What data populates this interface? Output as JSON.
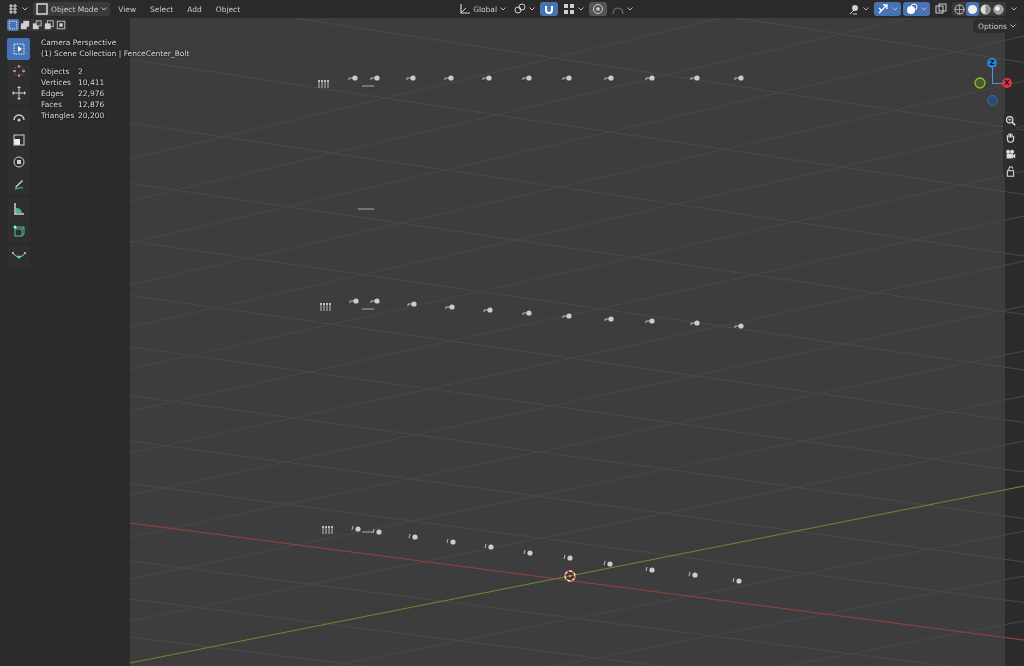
{
  "header": {
    "editor_type": {
      "kind": "editor"
    },
    "mode": {
      "label": "Object Mode"
    },
    "menus": [
      "View",
      "Select",
      "Add",
      "Object"
    ],
    "center_tools": [
      {
        "kind": "orientation",
        "label": "Global"
      },
      {
        "kind": "pivot"
      },
      {
        "kind": "snap",
        "on": true
      },
      {
        "kind": "snap_target"
      },
      {
        "kind": "proportional",
        "on": false
      },
      {
        "kind": "falloff"
      }
    ],
    "right_tools": [
      {
        "kind": "visibility"
      },
      {
        "kind": "gizmos",
        "on": true
      },
      {
        "kind": "overlays",
        "on": true
      },
      {
        "kind": "xray",
        "on": false
      }
    ],
    "shading": [
      {
        "kind": "wireframe",
        "selected": false
      },
      {
        "kind": "solid",
        "selected": true
      },
      {
        "kind": "material",
        "selected": false
      },
      {
        "kind": "rendered",
        "selected": false
      }
    ]
  },
  "select_modes": [
    {
      "kind": "set",
      "selected": true
    },
    {
      "kind": "extend",
      "selected": false
    },
    {
      "kind": "subtract",
      "selected": false
    },
    {
      "kind": "difference",
      "selected": false
    },
    {
      "kind": "intersect",
      "selected": false
    }
  ],
  "tools": [
    {
      "kind": "select_box",
      "selected": true
    },
    {
      "kind": "cursor",
      "selected": false
    },
    {
      "kind": "move",
      "selected": false
    },
    {
      "kind": "rotate",
      "selected": false
    },
    {
      "kind": "scale",
      "selected": false
    },
    {
      "kind": "transform",
      "selected": false
    },
    {
      "kind": "annotate",
      "selected": false
    },
    {
      "kind": "measure",
      "selected": false
    },
    {
      "kind": "add_cube",
      "selected": false
    },
    {
      "kind": "curve",
      "selected": false
    }
  ],
  "viewport_info": {
    "view": "Camera Perspective",
    "collection": "(1) Scene Collection | FenceCenter_Bolt",
    "stats": [
      {
        "label": "Objects",
        "value": "2"
      },
      {
        "label": "Vertices",
        "value": "10,411"
      },
      {
        "label": "Edges",
        "value": "22,976"
      },
      {
        "label": "Faces",
        "value": "12,876"
      },
      {
        "label": "Triangles",
        "value": "20,200"
      }
    ]
  },
  "options_button": "Options",
  "gizmo": {
    "z_label": "Z",
    "x_label": "X"
  },
  "nav_buttons": [
    {
      "kind": "zoom"
    },
    {
      "kind": "pan"
    },
    {
      "kind": "camera"
    },
    {
      "kind": "lock"
    }
  ]
}
